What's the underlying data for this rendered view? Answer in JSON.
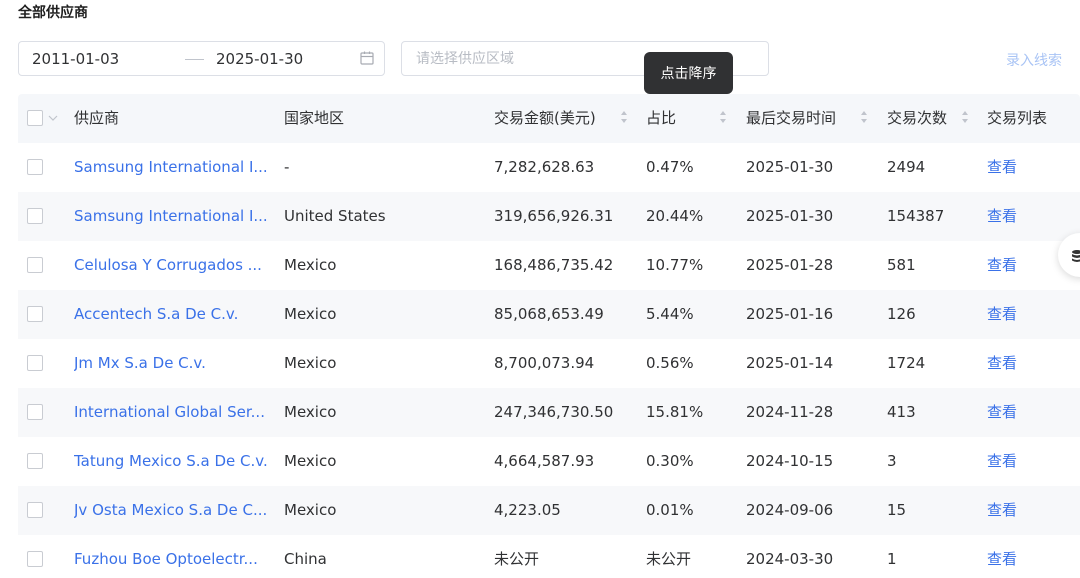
{
  "section_title": "全部供应商",
  "filters": {
    "date_start": "2011-01-03",
    "date_end": "2025-01-30",
    "region_placeholder": "请选择供应区域",
    "action_link": "录入线索"
  },
  "tooltip": "点击降序",
  "table": {
    "columns": {
      "supplier": "供应商",
      "region": "国家地区",
      "amount": "交易金额(美元)",
      "ratio": "占比",
      "last_time": "最后交易时间",
      "count": "交易次数",
      "list": "交易列表"
    },
    "rows": [
      {
        "supplier": "Samsung International I...",
        "region": "-",
        "amount": "7,282,628.63",
        "ratio": "0.47%",
        "last_time": "2025-01-30",
        "count": "2494",
        "action": "查看"
      },
      {
        "supplier": "Samsung International I...",
        "region": "United States",
        "amount": "319,656,926.31",
        "ratio": "20.44%",
        "last_time": "2025-01-30",
        "count": "154387",
        "action": "查看"
      },
      {
        "supplier": "Celulosa Y Corrugados ...",
        "region": "Mexico",
        "amount": "168,486,735.42",
        "ratio": "10.77%",
        "last_time": "2025-01-28",
        "count": "581",
        "action": "查看"
      },
      {
        "supplier": "Accentech S.a De C.v.",
        "region": "Mexico",
        "amount": "85,068,653.49",
        "ratio": "5.44%",
        "last_time": "2025-01-16",
        "count": "126",
        "action": "查看"
      },
      {
        "supplier": "Jm Mx S.a De C.v.",
        "region": "Mexico",
        "amount": "8,700,073.94",
        "ratio": "0.56%",
        "last_time": "2025-01-14",
        "count": "1724",
        "action": "查看"
      },
      {
        "supplier": "International Global Ser...",
        "region": "Mexico",
        "amount": "247,346,730.50",
        "ratio": "15.81%",
        "last_time": "2024-11-28",
        "count": "413",
        "action": "查看"
      },
      {
        "supplier": "Tatung Mexico S.a De C.v.",
        "region": "Mexico",
        "amount": "4,664,587.93",
        "ratio": "0.30%",
        "last_time": "2024-10-15",
        "count": "3",
        "action": "查看"
      },
      {
        "supplier": "Jv Osta Mexico S.a De C...",
        "region": "Mexico",
        "amount": "4,223.05",
        "ratio": "0.01%",
        "last_time": "2024-09-06",
        "count": "15",
        "action": "查看"
      },
      {
        "supplier": "Fuzhou Boe Optoelectr...",
        "region": "China",
        "amount": "未公开",
        "ratio": "未公开",
        "last_time": "2024-03-30",
        "count": "1",
        "action": "查看"
      }
    ]
  },
  "colors": {
    "link": "#3a71e8",
    "tooltip_bg": "#303133",
    "header_bg": "#f5f7fa"
  }
}
